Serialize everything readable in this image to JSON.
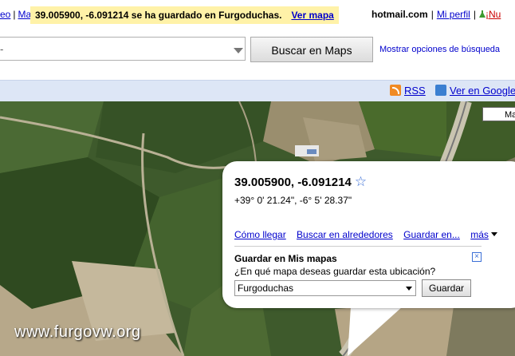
{
  "topbar": {
    "left_links": [
      "eo",
      "Ma"
    ],
    "notice_text": "39.005900, -6.091214 se ha guardado en Furgoduchas.",
    "notice_link": "Ver mapa",
    "email": "hotmail.com",
    "profile_link": "Mi perfil",
    "new_link": "¡Nu"
  },
  "search": {
    "value": "-",
    "button_label": "Buscar en Maps",
    "advanced_link": "Mostrar opciones de búsqueda"
  },
  "bluebar": {
    "rss_label": "RSS",
    "google_earth_label": "Ver en Google"
  },
  "map": {
    "type_button": "Ma",
    "watermark": "www.furgovw.org"
  },
  "infowindow": {
    "coords": "39.005900, -6.091214",
    "dms": "+39° 0' 21.24\", -6° 5' 28.37\"",
    "actions": {
      "directions": "Cómo llegar",
      "nearby": "Buscar en alrededores",
      "save_to": "Guardar en...",
      "more": "más"
    },
    "save_section_title": "Guardar en Mis mapas",
    "save_question": "¿En qué mapa deseas guardar esta ubicación?",
    "selected_map": "Furgoduchas",
    "save_button": "Guardar"
  },
  "colors": {
    "notice_bg": "#fff2a8",
    "link": "#0000cc",
    "bluebar_bg": "#dde6f6",
    "star": "#3b6fd6"
  }
}
